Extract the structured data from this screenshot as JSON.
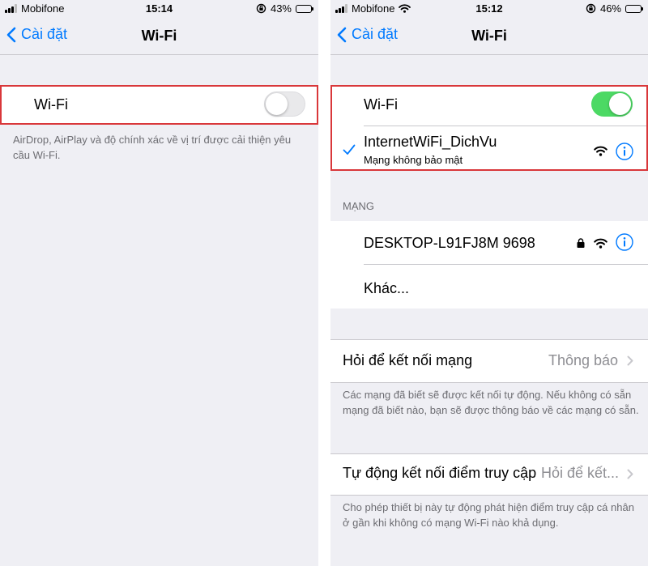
{
  "left": {
    "status": {
      "carrier": "Mobifone",
      "time": "15:14",
      "battery": "43%"
    },
    "nav": {
      "back": "Cài đặt",
      "title": "Wi-Fi"
    },
    "wifi": {
      "label": "Wi-Fi",
      "on": false
    },
    "footer": "AirDrop, AirPlay và độ chính xác về vị trí được cải thiện yêu cầu Wi-Fi."
  },
  "right": {
    "status": {
      "carrier": "Mobifone",
      "time": "15:12",
      "battery": "46%"
    },
    "nav": {
      "back": "Cài đặt",
      "title": "Wi-Fi"
    },
    "wifi": {
      "label": "Wi-Fi",
      "on": true
    },
    "connected": {
      "name": "InternetWiFi_DichVu",
      "subtitle": "Mạng không bảo mật"
    },
    "networks_header": "MẠNG",
    "networks": [
      {
        "name": "DESKTOP-L91FJ8M 9698"
      }
    ],
    "other": "Khác...",
    "ask_join": {
      "label": "Hỏi để kết nối mạng",
      "value": "Thông báo"
    },
    "ask_join_footer": "Các mạng đã biết sẽ được kết nối tự động. Nếu không có sẵn mạng đã biết nào, bạn sẽ được thông báo về các mạng có sẵn.",
    "auto_join": {
      "label": "Tự động kết nối điểm truy cập",
      "value": "Hỏi để kết..."
    },
    "auto_join_footer": "Cho phép thiết bị này tự động phát hiện điểm truy cập cá nhân ở gần khi không có mạng Wi-Fi nào khả dụng."
  },
  "colors": {
    "accent": "#007aff",
    "toggle_on": "#4cd964",
    "highlight": "#d9373a",
    "background": "#efeff4"
  }
}
